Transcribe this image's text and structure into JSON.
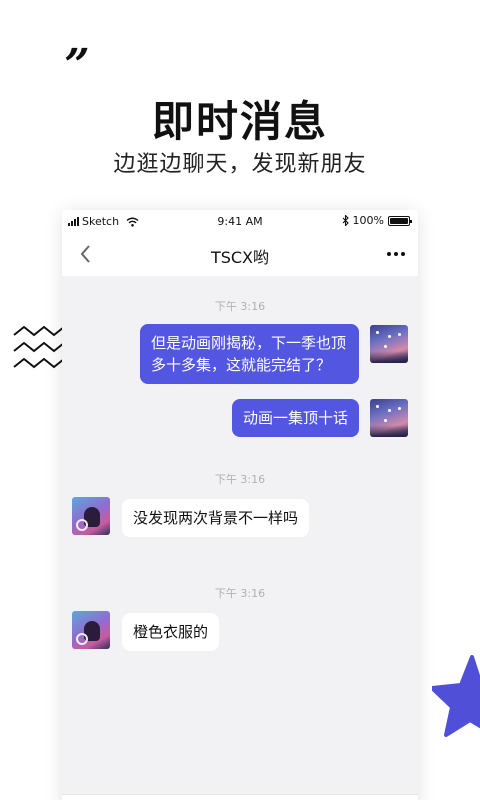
{
  "promo": {
    "quote_mark": "”",
    "title": "即时消息",
    "subtitle": "边逛边聊天，发现新朋友"
  },
  "status_bar": {
    "carrier": "Sketch",
    "time": "9:41 AM",
    "battery": "100%"
  },
  "nav": {
    "title": "TSCX哟",
    "back_icon": "chevron-left-icon",
    "more_icon": "more-dots-icon"
  },
  "messages": [
    {
      "type": "timestamp",
      "text": "下午 3:16"
    },
    {
      "type": "outgoing",
      "text": "但是动画刚揭秘，下一季也顶多十多集，这就能完结了？",
      "lines": [
        "但是动画刚揭秘，下一季也顶",
        "多十多集，这就能完结了？"
      ]
    },
    {
      "type": "outgoing",
      "text": "动画一集顶十话"
    },
    {
      "type": "timestamp",
      "text": "下午 3:16"
    },
    {
      "type": "incoming",
      "text": "没发现两次背景不一样吗"
    },
    {
      "type": "timestamp",
      "text": "下午 3:16"
    },
    {
      "type": "incoming",
      "text": "橙色衣服的"
    }
  ],
  "colors": {
    "accent": "#5356e1",
    "chat_background": "#f2f2f4",
    "star": "#4f4fd8"
  }
}
